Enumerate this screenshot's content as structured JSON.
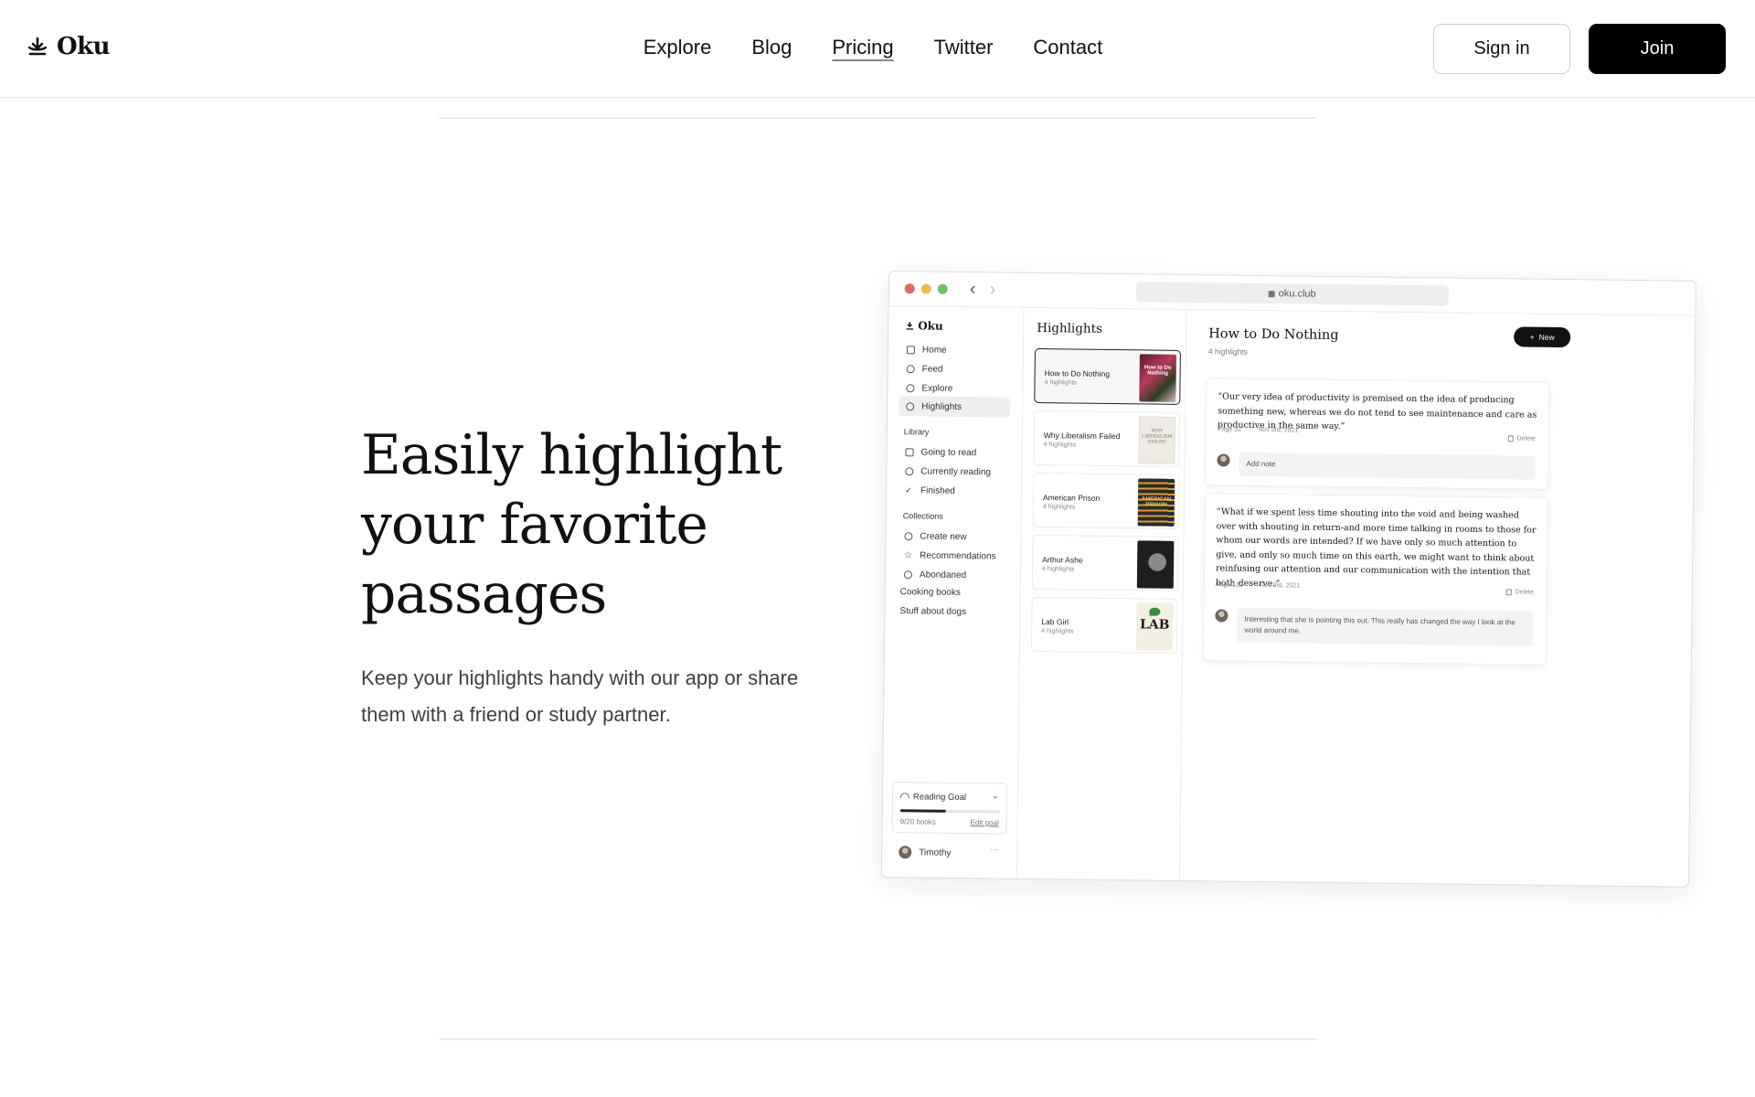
{
  "brand": {
    "name": "Oku"
  },
  "nav": {
    "items": [
      {
        "label": "Explore",
        "active": false
      },
      {
        "label": "Blog",
        "active": false
      },
      {
        "label": "Pricing",
        "active": true
      },
      {
        "label": "Twitter",
        "active": false
      },
      {
        "label": "Contact",
        "active": false
      }
    ],
    "sign_in": "Sign in",
    "join": "Join"
  },
  "hero": {
    "title": "Easily highlight your favorite passages",
    "subtitle": "Keep your highlights handy with our app or share them with a friend or study partner."
  },
  "mockup": {
    "url": "oku.club",
    "sidebar": {
      "logo": "Oku",
      "nav": [
        {
          "label": "Home",
          "icon": "home-icon"
        },
        {
          "label": "Feed",
          "icon": "sun-icon"
        },
        {
          "label": "Explore",
          "icon": "search-icon"
        },
        {
          "label": "Highlights",
          "icon": "highlight-icon",
          "selected": true
        }
      ],
      "library_heading": "Library",
      "library": [
        {
          "label": "Going to read",
          "icon": "bookmark-icon"
        },
        {
          "label": "Currently reading",
          "icon": "eye-icon"
        },
        {
          "label": "Finished",
          "icon": "check-icon"
        }
      ],
      "collections_heading": "Collections",
      "collections": [
        {
          "label": "Create new",
          "icon": "plus-icon"
        },
        {
          "label": "Recommendations",
          "icon": "star-icon"
        },
        {
          "label": "Abondaned",
          "icon": "clock-icon"
        }
      ],
      "custom_collections": [
        "Cooking books",
        "Stuff about dogs"
      ],
      "reading_goal": {
        "label": "Reading Goal",
        "progress_text": "9/20 books",
        "progress": 0.45,
        "edit": "Edit goal"
      },
      "user": {
        "name": "Timothy",
        "more": "···"
      }
    },
    "list": {
      "title": "Highlights",
      "books": [
        {
          "title": "How to Do Nothing",
          "count": "4 highlights",
          "cover_text": "How to Do Nothing",
          "selected": true
        },
        {
          "title": "Why Liberalism Failed",
          "count": "4 highlights",
          "cover_text": "WHY LIBERALISM FAILED"
        },
        {
          "title": "American Prison",
          "count": "4 highlights",
          "cover_text": "AMERICAN PRISON"
        },
        {
          "title": "Arthur Ashe",
          "count": "4 highlights",
          "cover_text": ""
        },
        {
          "title": "Lab Girl",
          "count": "4 highlights",
          "cover_text": "LAB"
        }
      ]
    },
    "detail": {
      "title": "How to Do Nothing",
      "count": "4 highlights",
      "new_button": "New",
      "highlights": [
        {
          "quote": "“Our very idea of productivity is premised on the idea of producing something new, whereas we do not tend to see maintenance and care as productive in the same way.”",
          "page": "Page 32",
          "date": "Nov 3rd, 2021",
          "delete": "Delete",
          "note_placeholder": "Add note",
          "note": ""
        },
        {
          "quote": "“What if we spent less time shouting into the void and being washed over with shouting in return-and more time talking in rooms to those for whom our words are intended? If we have only so much attention to give, and only so much time on this earth, we might want to think about reinfusing our attention and our communication with the intention that both deserve.”",
          "page": "Page 122",
          "date": "Nov 3rd, 2021",
          "delete": "Delete",
          "note": "Interesting that she is pointing this out. This really has changed the way I look at the world around me."
        }
      ]
    }
  }
}
